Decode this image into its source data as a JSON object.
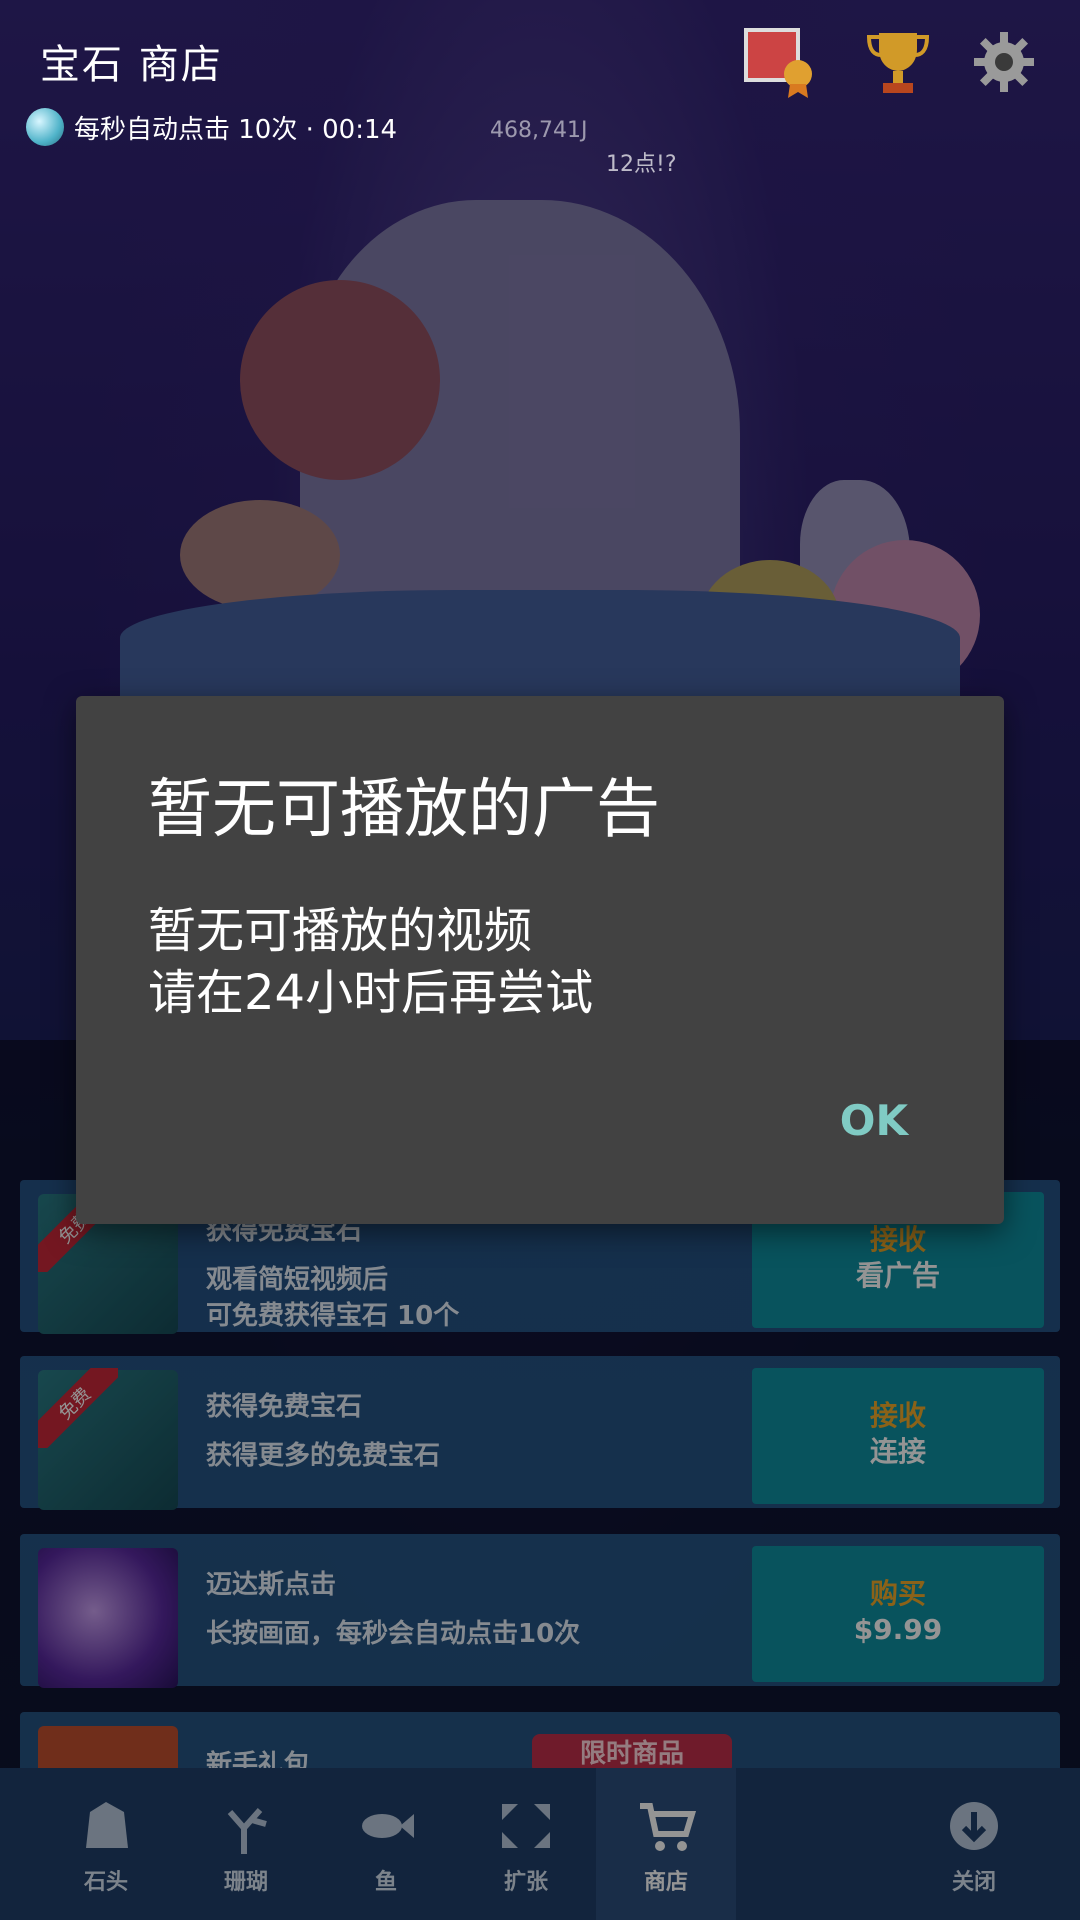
{
  "top_bar": {
    "title": "宝石 商店",
    "auto_click_text": "每秒自动点击 10次 · 00:14",
    "icons": [
      "photo-medal-icon",
      "trophy-icon",
      "gear-icon"
    ]
  },
  "floating_labels": {
    "count_a": "468,741J",
    "count_b": "12点!?"
  },
  "shop_items": [
    {
      "tag": "免费",
      "title": "获得免费宝石",
      "desc": "观看简短视频后\n可免费获得宝石 10个",
      "btn_line1": "接收",
      "btn_line2": "看广告"
    },
    {
      "tag": "免费",
      "title": "获得免费宝石",
      "desc": "获得更多的免费宝石",
      "btn_line1": "接收",
      "btn_line2": "连接"
    },
    {
      "tag": "",
      "title": "迈达斯点击",
      "desc": "长按画面，每秒会自动点击10次",
      "btn_line1": "购买",
      "btn_line2": "$9.99"
    },
    {
      "tag": "",
      "title": "新手礼包",
      "badge": "限时商品",
      "desc": "",
      "btn_line1": "",
      "btn_line2": ""
    }
  ],
  "nav": {
    "items": [
      {
        "label": "石头",
        "icon": "rock-icon"
      },
      {
        "label": "珊瑚",
        "icon": "coral-icon"
      },
      {
        "label": "鱼",
        "icon": "fish-icon"
      },
      {
        "label": "扩张",
        "icon": "expand-icon"
      },
      {
        "label": "商店",
        "icon": "cart-icon"
      },
      {
        "label": "关闭",
        "icon": "close-down-icon"
      }
    ],
    "active": "商店"
  },
  "dialog": {
    "title": "暂无可播放的广告",
    "message": "暂无可播放的视频\n请在24小时后再尝试",
    "ok_label": "OK"
  },
  "colors": {
    "accent_ok": "#80cbc4",
    "dialog_bg": "#424242",
    "buy_text": "#f0a92a"
  }
}
